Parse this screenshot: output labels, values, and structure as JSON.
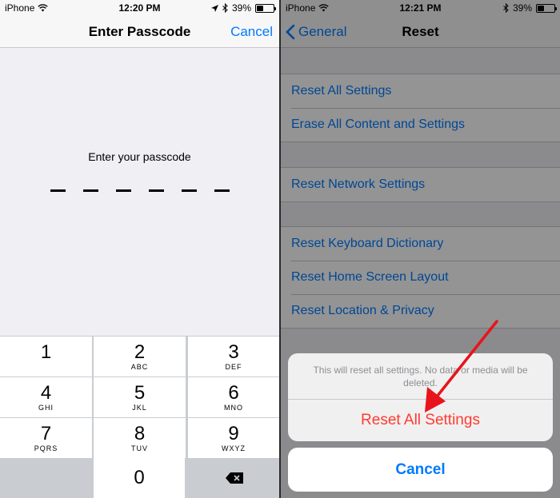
{
  "left": {
    "status": {
      "carrier": "iPhone",
      "time": "12:20 PM",
      "battery": "39%",
      "battery_level": 0.39
    },
    "nav": {
      "title": "Enter Passcode",
      "cancel": "Cancel"
    },
    "prompt": "Enter your passcode",
    "passcode_length": 6,
    "keypad": {
      "keys": [
        {
          "num": "1",
          "letters": ""
        },
        {
          "num": "2",
          "letters": "ABC"
        },
        {
          "num": "3",
          "letters": "DEF"
        },
        {
          "num": "4",
          "letters": "GHI"
        },
        {
          "num": "5",
          "letters": "JKL"
        },
        {
          "num": "6",
          "letters": "MNO"
        },
        {
          "num": "7",
          "letters": "PQRS"
        },
        {
          "num": "8",
          "letters": "TUV"
        },
        {
          "num": "9",
          "letters": "WXYZ"
        }
      ],
      "zero": "0"
    }
  },
  "right": {
    "status": {
      "carrier": "iPhone",
      "time": "12:21 PM",
      "battery": "39%",
      "battery_level": 0.39
    },
    "nav": {
      "back": "General",
      "title": "Reset"
    },
    "groups": [
      [
        "Reset All Settings",
        "Erase All Content and Settings"
      ],
      [
        "Reset Network Settings"
      ],
      [
        "Reset Keyboard Dictionary",
        "Reset Home Screen Layout",
        "Reset Location & Privacy"
      ]
    ],
    "sheet": {
      "message": "This will reset all settings. No data or media will be deleted.",
      "action": "Reset All Settings",
      "cancel": "Cancel"
    }
  },
  "colors": {
    "ios_blue": "#007aff",
    "destructive_red": "#ff3b30",
    "annotation_arrow": "#e8141b"
  }
}
